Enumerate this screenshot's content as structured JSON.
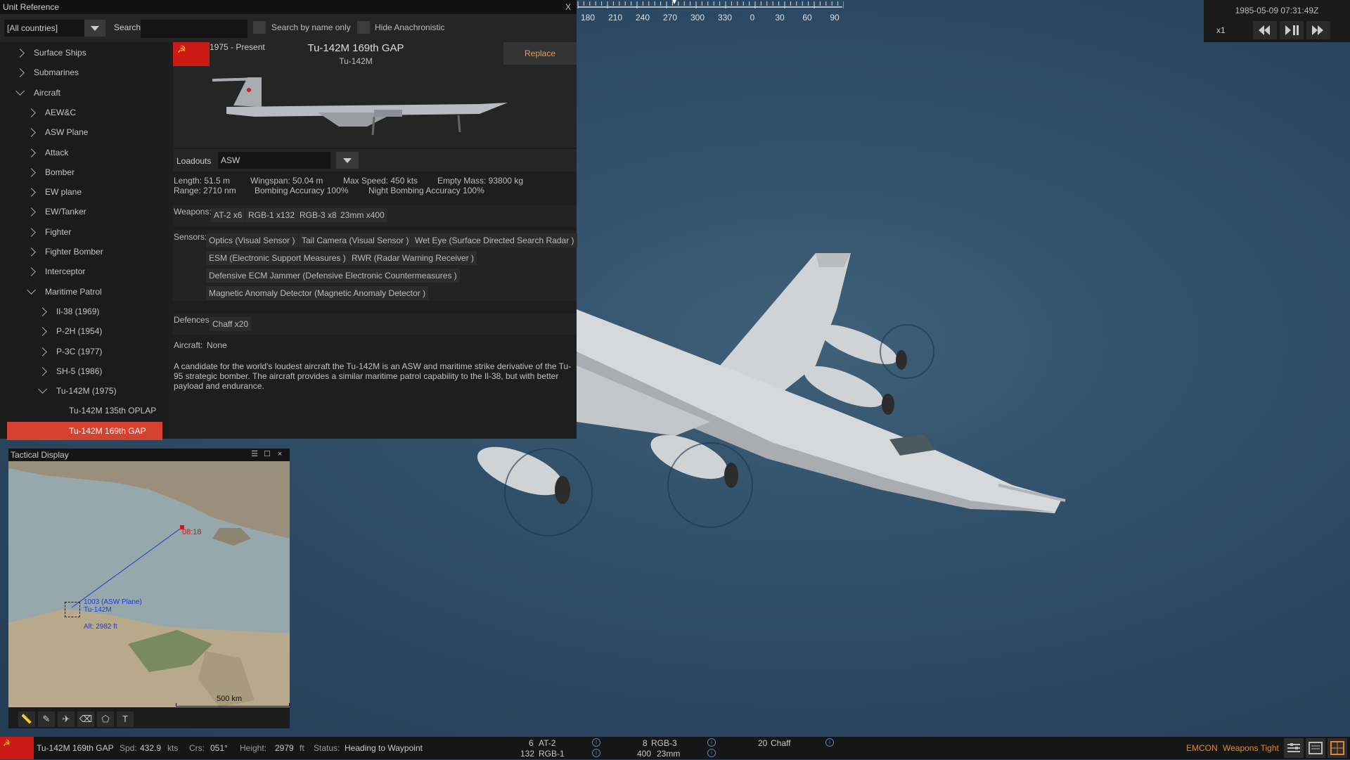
{
  "unit_reference": {
    "title": "Unit Reference",
    "close": "X",
    "country_filter": "[All countries]",
    "search_label": "Search",
    "search_value": "",
    "search_by_name_only": "Search by name only",
    "hide_anachronistic": "Hide Anachronistic",
    "tree": [
      {
        "label": "Surface Ships",
        "level": 0,
        "state": "collapsed"
      },
      {
        "label": "Submarines",
        "level": 0,
        "state": "collapsed"
      },
      {
        "label": "Aircraft",
        "level": 0,
        "state": "expanded"
      },
      {
        "label": "AEW&C",
        "level": 1,
        "state": "collapsed"
      },
      {
        "label": "ASW Plane",
        "level": 1,
        "state": "collapsed"
      },
      {
        "label": "Attack",
        "level": 1,
        "state": "collapsed"
      },
      {
        "label": "Bomber",
        "level": 1,
        "state": "collapsed"
      },
      {
        "label": "EW plane",
        "level": 1,
        "state": "collapsed"
      },
      {
        "label": "EW/Tanker",
        "level": 1,
        "state": "collapsed"
      },
      {
        "label": "Fighter",
        "level": 1,
        "state": "collapsed"
      },
      {
        "label": "Fighter Bomber",
        "level": 1,
        "state": "collapsed"
      },
      {
        "label": "Interceptor",
        "level": 1,
        "state": "collapsed"
      },
      {
        "label": "Maritime Patrol",
        "level": 1,
        "state": "expanded"
      },
      {
        "label": "Il-38 (1969)",
        "level": 2,
        "state": "collapsed"
      },
      {
        "label": "P-2H (1954)",
        "level": 2,
        "state": "collapsed"
      },
      {
        "label": "P-3C (1977)",
        "level": 2,
        "state": "collapsed"
      },
      {
        "label": "SH-5 (1986)",
        "level": 2,
        "state": "collapsed"
      },
      {
        "label": "Tu-142M (1975)",
        "level": 2,
        "state": "expanded"
      },
      {
        "label": "Tu-142M 135th OPLAP",
        "level": 3,
        "state": "leaf"
      },
      {
        "label": "Tu-142M 169th GAP",
        "level": 3,
        "state": "selected"
      }
    ],
    "detail": {
      "flag_symbol": "☭",
      "years": "1975 - Present",
      "name": "Tu-142M 169th GAP",
      "type": "Tu-142M",
      "replace": "Replace",
      "loadouts_label": "Loadouts",
      "loadout": "ASW",
      "specs": {
        "length": "Length: 51.5 m",
        "wingspan": "Wingspan: 50.04 m",
        "max_speed": "Max Speed: 450 kts",
        "empty_mass": "Empty Mass: 93800 kg",
        "range": "Range: 2710 nm",
        "bombing_acc": "Bombing Accuracy 100%",
        "night_bombing_acc": "Night Bombing Accuracy 100%"
      },
      "weapons_label": "Weapons:",
      "weapons": [
        "AT-2 x6",
        "RGB-1 x132",
        "RGB-3 x8",
        "23mm x400"
      ],
      "sensors_label": "Sensors:",
      "sensors": [
        "Optics (Visual Sensor )",
        "Tail Camera (Visual Sensor )",
        "Wet Eye (Surface Directed Search Radar )",
        "ESM (Electronic Support Measures )",
        "RWR (Radar Warning Receiver )",
        "Defensive ECM Jammer (Defensive Electronic Countermeasures )",
        "Magnetic Anomaly Detector (Magnetic Anomaly Detector )"
      ],
      "defences_label": "Defences:",
      "defences": [
        "Chaff x20"
      ],
      "aircraft_label": "Aircraft:",
      "aircraft_value": "None",
      "description": "A candidate for the world's loudest aircraft the Tu-142M is an ASW and maritime strike derivative of the Tu-95 strategic bomber. The aircraft provides a similar maritime patrol capability to the Il-38, but with better payload and endurance."
    }
  },
  "compass": {
    "labels": [
      "180",
      "210",
      "240",
      "270",
      "300",
      "330",
      "0",
      "30",
      "60",
      "90"
    ]
  },
  "time_panel": {
    "datetime": "1985-05-09 07:31:49Z",
    "speed": "x1",
    "rewind_icon": "rewind-icon",
    "play_pause_icon": "play-pause-icon",
    "fast_forward_icon": "fast-forward-icon"
  },
  "tactical_display": {
    "title": "Tactical Display",
    "waypoint_time": "08:18",
    "unit_label_1": "1003 (ASW Plane)",
    "unit_label_2": "Tu-142M",
    "unit_alt": "Alt: 2982 ft",
    "scale": "500 km",
    "text_tool": "T"
  },
  "status_bar": {
    "unit": "Tu-142M 169th GAP",
    "spd_label": "Spd:",
    "spd_value": "432.9",
    "spd_unit": "kts",
    "crs_label": "Crs:",
    "crs_value": "051°",
    "height_label": "Height:",
    "height_value": "2979",
    "height_unit": "ft",
    "status_label": "Status:",
    "status_value": "Heading to Waypoint",
    "weapons": [
      {
        "count": "6",
        "name": "AT-2"
      },
      {
        "count": "132",
        "name": "RGB-1"
      },
      {
        "count": "8",
        "name": "RGB-3"
      },
      {
        "count": "400",
        "name": "23mm"
      },
      {
        "count": "20",
        "name": "Chaff"
      }
    ],
    "emcon": "EMCON",
    "weapons_state": "Weapons Tight",
    "colors": {
      "accent": "#e08a30",
      "selected": "#d64230",
      "flag": "#cc1a14",
      "track": "#1e3cd0",
      "waypoint": "#e01010"
    }
  }
}
